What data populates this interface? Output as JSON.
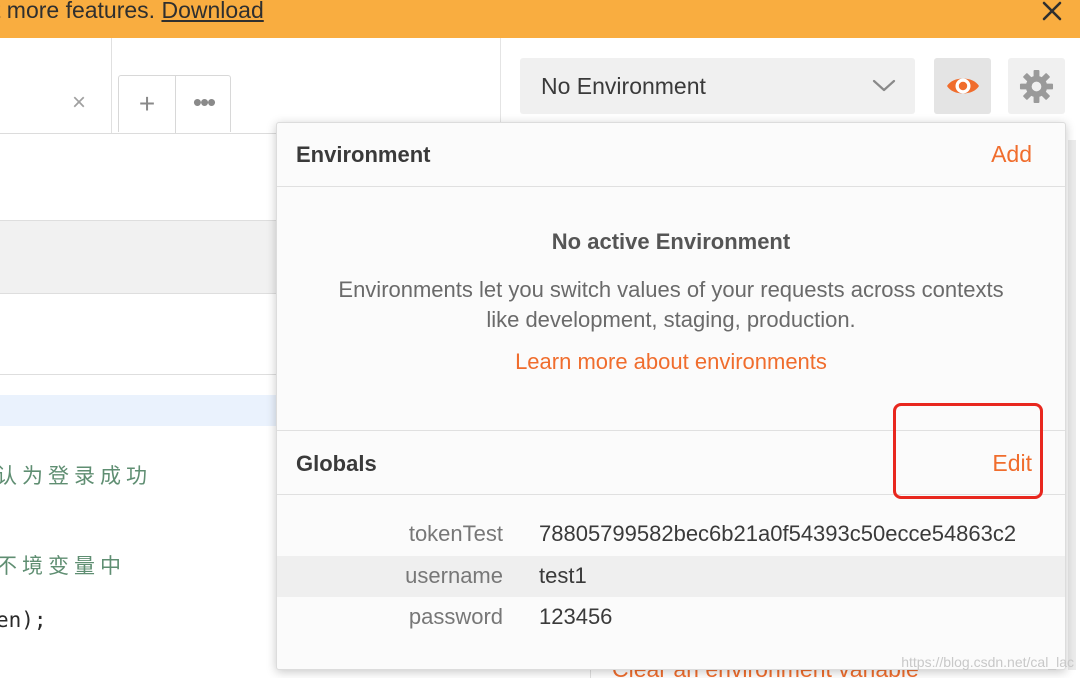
{
  "banner": {
    "text": "t more features. ",
    "link": "Download",
    "close_icon": "close-icon"
  },
  "editor": {
    "tab_close_glyph": "×",
    "new_tab_glyph": "+",
    "more_glyph": "•••",
    "code_lines": [
      {
        "text": "认为登录成功",
        "kind": "comment"
      },
      {
        "text": "不境变量中",
        "kind": "comment"
      },
      {
        "text": "en);",
        "kind": "plain"
      }
    ]
  },
  "env_selector": {
    "selected": "No Environment",
    "chevron_icon": "chevron-down-icon",
    "quick_look_icon": "eye-icon",
    "settings_icon": "gear-icon"
  },
  "popover": {
    "environment_title": "Environment",
    "add_label": "Add",
    "empty_title": "No active Environment",
    "empty_description": "Environments let you switch values of your requests across contexts like development, staging, production.",
    "learn_more": "Learn more about environments",
    "globals_title": "Globals",
    "edit_label": "Edit",
    "globals": [
      {
        "key": "tokenTest",
        "value": "78805799582bec6b21a0f54393c50ecce54863c2"
      },
      {
        "key": "username",
        "value": "test1"
      },
      {
        "key": "password",
        "value": "123456"
      }
    ]
  },
  "bottom_link": "Clear an environment variable",
  "watermark": "https://blog.csdn.net/cal_lac",
  "colors": {
    "accent": "#f06d2d",
    "banner": "#f9ad40",
    "highlight": "#e8271e"
  }
}
